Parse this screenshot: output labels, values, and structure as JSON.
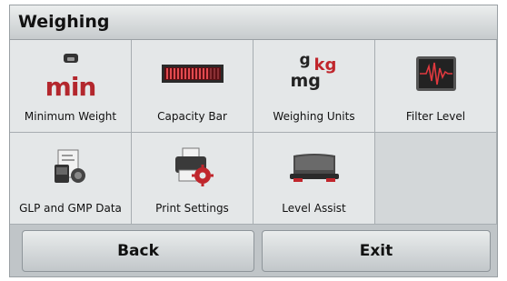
{
  "header": {
    "title": "Weighing"
  },
  "tiles": [
    {
      "label": "Minimum Weight",
      "icon": "minimum-weight-icon",
      "icon_text": "min"
    },
    {
      "label": "Capacity Bar",
      "icon": "capacity-bar-icon"
    },
    {
      "label": "Weighing Units",
      "icon": "weighing-units-icon",
      "units": {
        "g": "g",
        "kg": "kg",
        "mg": "mg"
      }
    },
    {
      "label": "Filter Level",
      "icon": "filter-level-icon"
    },
    {
      "label": "GLP and GMP Data",
      "icon": "glp-gmp-data-icon"
    },
    {
      "label": "Print Settings",
      "icon": "print-settings-icon"
    },
    {
      "label": "Level Assist",
      "icon": "level-assist-icon"
    }
  ],
  "footer": {
    "back_label": "Back",
    "exit_label": "Exit"
  },
  "colors": {
    "accent_red": "#c0262c",
    "panel": "#e4e7e8",
    "frame": "#c9cdd0"
  }
}
